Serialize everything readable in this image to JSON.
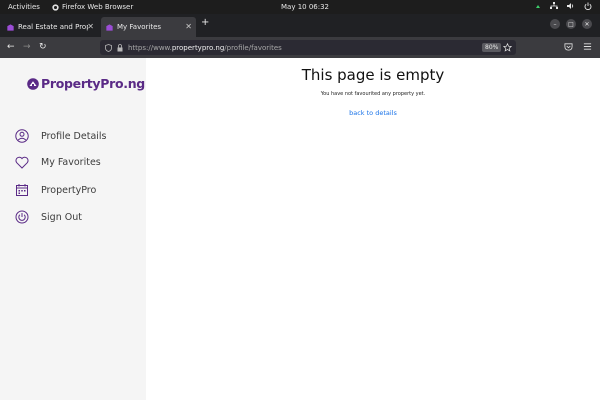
{
  "system": {
    "activities": "Activities",
    "app_name": "Firefox Web Browser",
    "clock": "May 10  06:32"
  },
  "browser": {
    "tabs": [
      {
        "label": "Real Estate and Property",
        "active": false
      },
      {
        "label": "My Favorites",
        "active": true
      }
    ],
    "url_prefix": "https://www.",
    "url_host": "propertypro.ng",
    "url_path": "/profile/favorites",
    "zoom": "80%"
  },
  "sidebar": {
    "logo": "PropertyPro.ng",
    "items": [
      {
        "label": "Profile Details",
        "icon": "person-circle-icon"
      },
      {
        "label": "My Favorites",
        "icon": "heart-icon"
      },
      {
        "label": "PropertyPro",
        "icon": "calendar-icon"
      },
      {
        "label": "Sign Out",
        "icon": "power-icon"
      }
    ]
  },
  "main": {
    "title": "This page is empty",
    "subtitle": "You have not favourited any property yet.",
    "link": "back to details"
  },
  "colors": {
    "brand": "#5a2a86",
    "link": "#1a73e8",
    "sidebar_bg": "#f5f5f5"
  }
}
